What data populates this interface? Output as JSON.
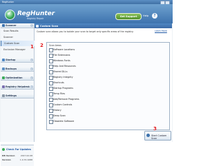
{
  "window": {
    "title": "RegHunter"
  },
  "header": {
    "brand": "RegHunter",
    "tagline": "Registry Repair",
    "support_label": "Get Support",
    "help_label": "Help"
  },
  "sidebar": {
    "groups": [
      {
        "label": "Scanner",
        "items": [
          "Scan Results",
          "Scanner",
          "Custom Scan",
          "Exclusion Manager"
        ]
      },
      {
        "label": "Startup",
        "items": []
      },
      {
        "label": "Backups",
        "items": []
      },
      {
        "label": "Optimization",
        "items": []
      },
      {
        "label": "Registry Helpdesk",
        "items": []
      },
      {
        "label": "Settings",
        "items": []
      }
    ],
    "active_item": "Custom Scan",
    "check_updates": "Check For Updates",
    "info": [
      {
        "key": "DB Version",
        "value": "2017.02.08"
      },
      {
        "key": "Version",
        "value": "1.0.70.1088"
      }
    ]
  },
  "main": {
    "title": "Custom Scan",
    "description": "Custom scan allows you to isolate your scan to target only specific areas of the registry.",
    "learn_more": "Learn More",
    "scan_areas_header": "Scan Areas",
    "areas": [
      "Software Locations",
      "File Extensions",
      "Windows Fonts",
      "Help And Resources",
      "Shared DLLs",
      "Registry Integrity",
      "Shortcuts",
      "Startup Programs",
      "Temp Files",
      "Add/Remove Programs",
      "Custom Controls",
      "History",
      "Deep Scan",
      "Obsolete Software"
    ],
    "start_button": "Start Custom Scan"
  },
  "annotations": {
    "step1": "1",
    "step2": "2",
    "step3": "3"
  },
  "colors": {
    "accent": "#3e73ae",
    "annotation": "#e2191c",
    "support": "#4f8f2a"
  }
}
